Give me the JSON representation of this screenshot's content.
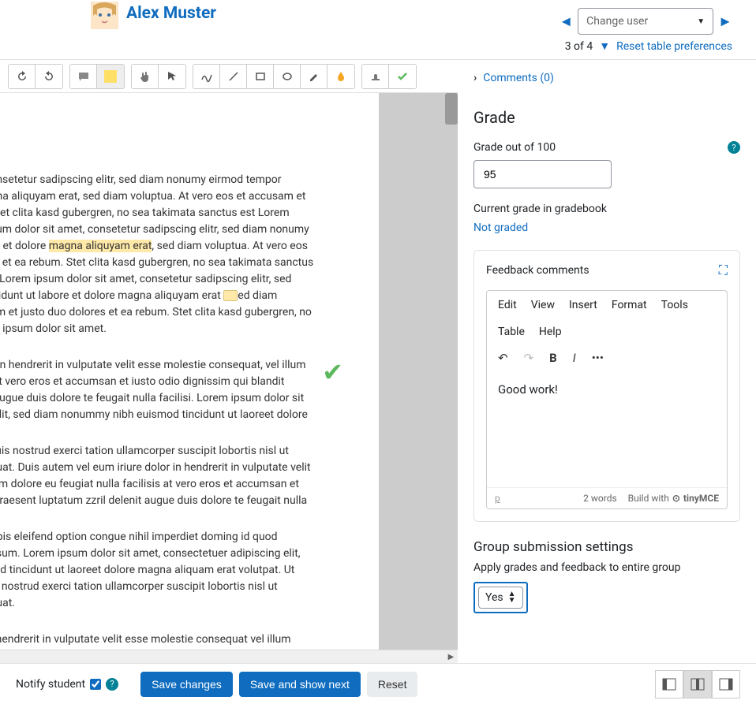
{
  "header": {
    "student_name": "Alex Muster",
    "change_user": "Change user",
    "pager": "3 of 4",
    "reset_link": "Reset table preferences"
  },
  "pdf": {
    "p1a": "consetetur sadipscing elitr, sed diam nonumy eirmod tempor",
    "p1b": "agna aliquyam erat, sed diam voluptua. At vero eos et accusam et",
    "p1c": ". Stet clita kasd gubergren, no sea takimata sanctus est Lorem",
    "p1d": "psum dolor sit amet, consetetur sadipscing elitr, sed diam nonumy",
    "p1e": "ore et dolore ",
    "p1hl": "magna aliquyam erat",
    "p1f": ", sed diam voluptua. At vero eos",
    "p1g": "res et ea rebum. Stet clita kasd gubergren, no sea takimata sanctus",
    "p1h": "et. Lorem ipsum dolor sit amet, consetetur sadipscing elitr, sed",
    "p1i": "invidunt ut labore et dolore magna aliquyam erat",
    "p1j": "ed diam",
    "p1k": "sam et justo duo dolores et ea rebum. Stet clita kasd gubergren, no",
    "p1l": "em ipsum dolor sit amet.",
    "p2a": "or in hendrerit in vulputate velit esse molestie consequat, vel illum",
    "p2b": "s at vero eros et accumsan et iusto odio dignissim qui blandit",
    "p2c": "it augue duis dolore te feugait nulla facilisi. Lorem ipsum dolor sit",
    "p2d": "g elit, sed diam nonummy nibh euismod tincidunt ut laoreet dolore",
    "p3a": ", quis nostrud exerci tation ullamcorper suscipit lobortis nisl ut",
    "p3b": "equat. Duis autem vel eum iriure dolor in hendrerit in vulputate velit",
    "p3c": "illum dolore eu feugiat nulla facilisis at vero eros et accumsan et",
    "p3d": "it praesent luptatum zzril delenit augue duis dolore te feugait nulla",
    "p4a": "nobis eleifend option congue nihil imperdiet doming id quod",
    "p4b": "assum. Lorem ipsum dolor sit amet, consectetuer adipiscing elit,",
    "p4c": "mod tincidunt ut laoreet dolore magna aliquam erat volutpat. Ut",
    "p4d": "uis nostrud exerci tation ullamcorper suscipit lobortis nisl ut",
    "p4e": "equat.",
    "p5": "in hendrerit in vulputate velit esse molestie consequat  vel illum"
  },
  "right": {
    "comments": "Comments (0)",
    "grade_h": "Grade",
    "grade_label": "Grade out of 100",
    "grade_value": "95",
    "current_grade": "Current grade in gradebook",
    "not_graded": "Not graded",
    "feedback_h": "Feedback comments",
    "menu": {
      "edit": "Edit",
      "view": "View",
      "insert": "Insert",
      "format": "Format",
      "tools": "Tools",
      "table": "Table",
      "help": "Help"
    },
    "feedback_text": "Good work!",
    "words": "2 words",
    "tiny": "Build with",
    "tinybrand": "tinyMCE",
    "group_h": "Group submission settings",
    "group_sub": "Apply grades and feedback to entire group",
    "yes": "Yes"
  },
  "footer": {
    "notify": "Notify student",
    "save": "Save changes",
    "savenext": "Save and show next",
    "reset": "Reset"
  }
}
